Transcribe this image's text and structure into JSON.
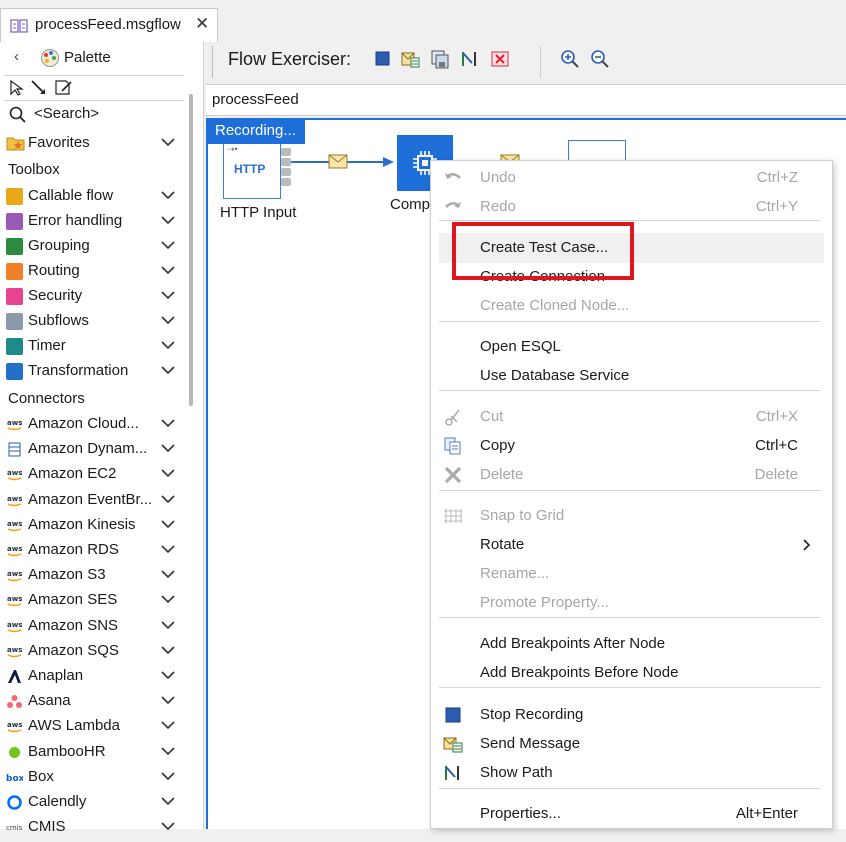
{
  "tab": {
    "title": "processFeed.msgflow",
    "close": "✕"
  },
  "palette": {
    "title": "Palette",
    "search": "<Search>",
    "favorites": "Favorites",
    "toolbox_heading": "Toolbox",
    "toolbox": [
      {
        "label": "Callable flow",
        "color": "#e8a817",
        "icon": "callable-flow-icon"
      },
      {
        "label": "Error handling",
        "color": "#9b59b6",
        "icon": "error-handling-icon"
      },
      {
        "label": "Grouping",
        "color": "#2e8b3d",
        "icon": "grouping-icon"
      },
      {
        "label": "Routing",
        "color": "#f07f2a",
        "icon": "routing-icon"
      },
      {
        "label": "Security",
        "color": "#e84393",
        "icon": "security-icon"
      },
      {
        "label": "Subflows",
        "color": "#8a9aa8",
        "icon": "subflows-icon"
      },
      {
        "label": "Timer",
        "color": "#1f8a8a",
        "icon": "timer-icon"
      },
      {
        "label": "Transformation",
        "color": "#2270c8",
        "icon": "transformation-icon"
      }
    ],
    "connectors_heading": "Connectors",
    "connectors": [
      {
        "label": "Amazon Cloud...",
        "icon": "aws-icon"
      },
      {
        "label": "Amazon Dynam...",
        "icon": "dynamodb-icon"
      },
      {
        "label": "Amazon EC2",
        "icon": "aws-icon"
      },
      {
        "label": "Amazon EventBr...",
        "icon": "aws-icon"
      },
      {
        "label": "Amazon Kinesis",
        "icon": "aws-icon"
      },
      {
        "label": "Amazon RDS",
        "icon": "aws-icon"
      },
      {
        "label": "Amazon S3",
        "icon": "aws-icon"
      },
      {
        "label": "Amazon SES",
        "icon": "aws-icon"
      },
      {
        "label": "Amazon SNS",
        "icon": "aws-icon"
      },
      {
        "label": "Amazon SQS",
        "icon": "aws-icon"
      },
      {
        "label": "Anaplan",
        "icon": "anaplan-icon"
      },
      {
        "label": "Asana",
        "icon": "asana-icon"
      },
      {
        "label": "AWS Lambda",
        "icon": "aws-icon"
      },
      {
        "label": "BambooHR",
        "icon": "bamboohr-icon"
      },
      {
        "label": "Box",
        "icon": "box-icon"
      },
      {
        "label": "Calendly",
        "icon": "calendly-icon"
      },
      {
        "label": "CMIS",
        "icon": "cmis-icon"
      }
    ]
  },
  "toolbar": {
    "label": "Flow Exerciser:"
  },
  "breadcrumb": "processFeed",
  "canvas": {
    "recording": "Recording...",
    "http_node_text": "HTTP",
    "http_node_label": "HTTP Input",
    "compute_label_partial": "Comp"
  },
  "menu": {
    "items": [
      {
        "label": "Undo",
        "shortcut": "Ctrl+Z",
        "enabled": false,
        "icon": "undo-icon"
      },
      {
        "label": "Redo",
        "shortcut": "Ctrl+Y",
        "enabled": false,
        "icon": "redo-icon"
      },
      {
        "label": "Create Test Case...",
        "shortcut": "",
        "enabled": true
      },
      {
        "label": "Create Connection",
        "shortcut": "",
        "enabled": true
      },
      {
        "label": "Create Cloned Node...",
        "shortcut": "",
        "enabled": false
      },
      {
        "label": "Open ESQL",
        "shortcut": "",
        "enabled": true
      },
      {
        "label": "Use Database Service",
        "shortcut": "",
        "enabled": true
      },
      {
        "label": "Cut",
        "shortcut": "Ctrl+X",
        "enabled": false,
        "icon": "cut-icon"
      },
      {
        "label": "Copy",
        "shortcut": "Ctrl+C",
        "enabled": true,
        "icon": "copy-icon"
      },
      {
        "label": "Delete",
        "shortcut": "Delete",
        "enabled": false,
        "icon": "delete-icon"
      },
      {
        "label": "Snap to Grid",
        "shortcut": "",
        "enabled": false,
        "icon": "grid-icon"
      },
      {
        "label": "Rotate",
        "shortcut": "",
        "enabled": true,
        "submenu": true
      },
      {
        "label": "Rename...",
        "shortcut": "",
        "enabled": false
      },
      {
        "label": "Promote Property...",
        "shortcut": "",
        "enabled": false
      },
      {
        "label": "Add Breakpoints After Node",
        "shortcut": "",
        "enabled": true
      },
      {
        "label": "Add Breakpoints Before Node",
        "shortcut": "",
        "enabled": true
      },
      {
        "label": "Stop Recording",
        "shortcut": "",
        "enabled": true,
        "icon": "stop-icon"
      },
      {
        "label": "Send Message",
        "shortcut": "",
        "enabled": true,
        "icon": "send-message-icon"
      },
      {
        "label": "Show Path",
        "shortcut": "",
        "enabled": true,
        "icon": "show-path-icon"
      },
      {
        "label": "Properties...",
        "shortcut": "Alt+Enter",
        "enabled": true
      }
    ],
    "highlight_color": "#e0161e"
  }
}
